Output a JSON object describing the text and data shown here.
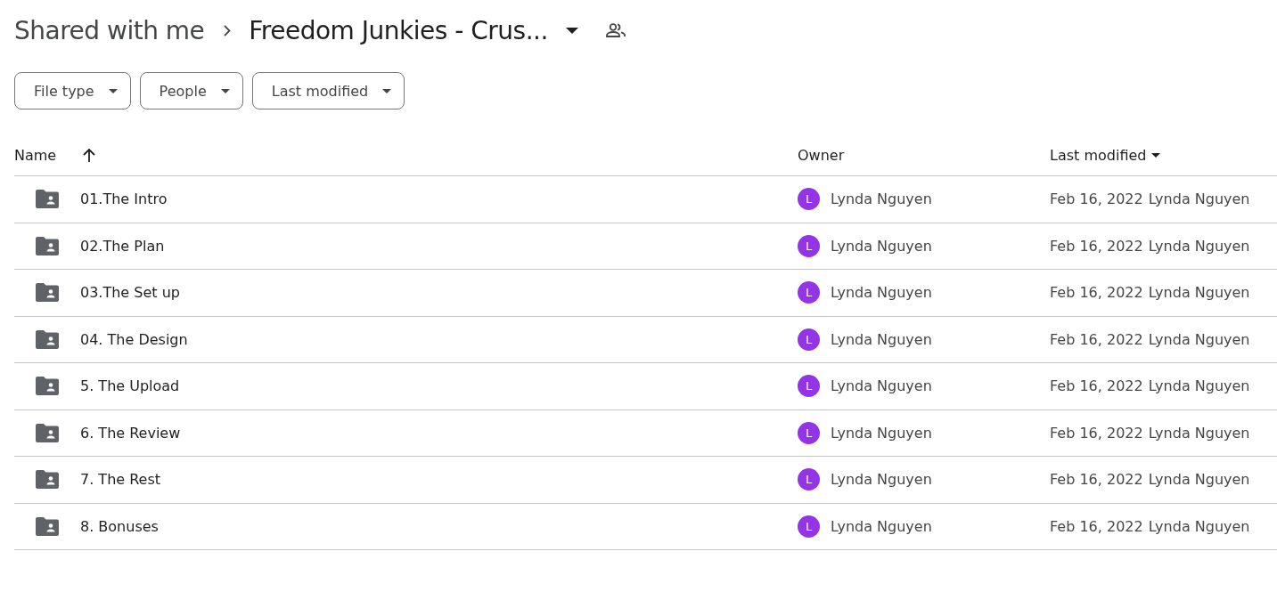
{
  "breadcrumb": {
    "parent": "Shared with me",
    "current": "Freedom Junkies - Crus..."
  },
  "filters": [
    "File type",
    "People",
    "Last modified"
  ],
  "table": {
    "columns": [
      "Name",
      "Owner",
      "Last modified"
    ],
    "rows": [
      {
        "name": "01.The Intro",
        "owner_initial": "L",
        "owner": "Lynda Nguyen",
        "modified": "Feb 16, 2022",
        "modified_by": "Lynda Nguyen"
      },
      {
        "name": "02.The Plan",
        "owner_initial": "L",
        "owner": "Lynda Nguyen",
        "modified": "Feb 16, 2022",
        "modified_by": "Lynda Nguyen"
      },
      {
        "name": "03.The Set up",
        "owner_initial": "L",
        "owner": "Lynda Nguyen",
        "modified": "Feb 16, 2022",
        "modified_by": "Lynda Nguyen"
      },
      {
        "name": "04. The Design",
        "owner_initial": "L",
        "owner": "Lynda Nguyen",
        "modified": "Feb 16, 2022",
        "modified_by": "Lynda Nguyen"
      },
      {
        "name": "5. The Upload",
        "owner_initial": "L",
        "owner": "Lynda Nguyen",
        "modified": "Feb 16, 2022",
        "modified_by": "Lynda Nguyen"
      },
      {
        "name": "6. The Review",
        "owner_initial": "L",
        "owner": "Lynda Nguyen",
        "modified": "Feb 16, 2022",
        "modified_by": "Lynda Nguyen"
      },
      {
        "name": "7. The Rest",
        "owner_initial": "L",
        "owner": "Lynda Nguyen",
        "modified": "Feb 16, 2022",
        "modified_by": "Lynda Nguyen"
      },
      {
        "name": "8. Bonuses",
        "owner_initial": "L",
        "owner": "Lynda Nguyen",
        "modified": "Feb 16, 2022",
        "modified_by": "Lynda Nguyen"
      }
    ]
  }
}
